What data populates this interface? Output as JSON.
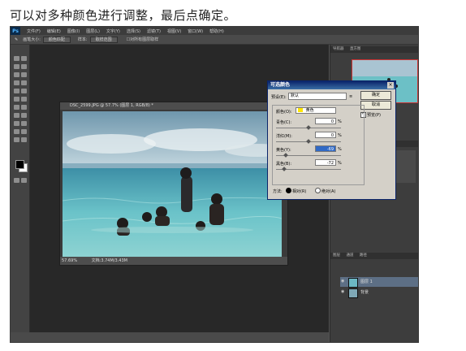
{
  "caption": "可以对多种颜色进行调整，最后点确定。",
  "app": {
    "logo": "Ps",
    "menus": [
      "文件(F)",
      "编辑(E)",
      "图像(I)",
      "图层(L)",
      "文字(Y)",
      "选择(S)",
      "滤镜(T)",
      "视图(V)",
      "窗口(W)",
      "帮助(H)"
    ],
    "options": {
      "label1": "画笔大小:",
      "sel1": "颜色匹配",
      "label2": "样本:",
      "sel2": "取样范围",
      "check": "对所有图层取样"
    }
  },
  "document": {
    "title": "DSC_2599.JPG @ 57.7% (图层 1, RGB/8) *",
    "zoom": "57.69%",
    "doc_info": "文档:3.74M/3.43M"
  },
  "dialog": {
    "title": "可选颜色",
    "preset_label": "预设(E):",
    "preset_value": "默认",
    "ok": "确定",
    "cancel": "取消",
    "preview": "预览(P)",
    "colors_label": "颜色(O):",
    "colors_value": "黄色",
    "rows": [
      {
        "label": "青色(C):",
        "value": "0",
        "unit": "%"
      },
      {
        "label": "洋红(M):",
        "value": "0",
        "unit": "%"
      },
      {
        "label": "黄色(Y):",
        "value": "-69",
        "unit": "%"
      },
      {
        "label": "黑色(B):",
        "value": "-72",
        "unit": "%"
      }
    ],
    "method_label": "方法:",
    "method_relative": "相对(R)",
    "method_absolute": "绝对(A)"
  },
  "panels": {
    "top_tabs": [
      "导航器",
      "直方图"
    ],
    "mid_tabs": [
      "颜色",
      "色板",
      "样式"
    ],
    "layer_tabs": [
      "图层",
      "通道",
      "路径"
    ],
    "layers": [
      {
        "name": "图层 1",
        "active": true
      },
      {
        "name": "背景",
        "active": false
      }
    ]
  },
  "colors": {
    "ui_bg": "#535353",
    "dialog_title": "#0a246a",
    "sea": "#5fb8c4",
    "sky": "#b9d2df",
    "yellow_swatch": "#ffe600"
  }
}
